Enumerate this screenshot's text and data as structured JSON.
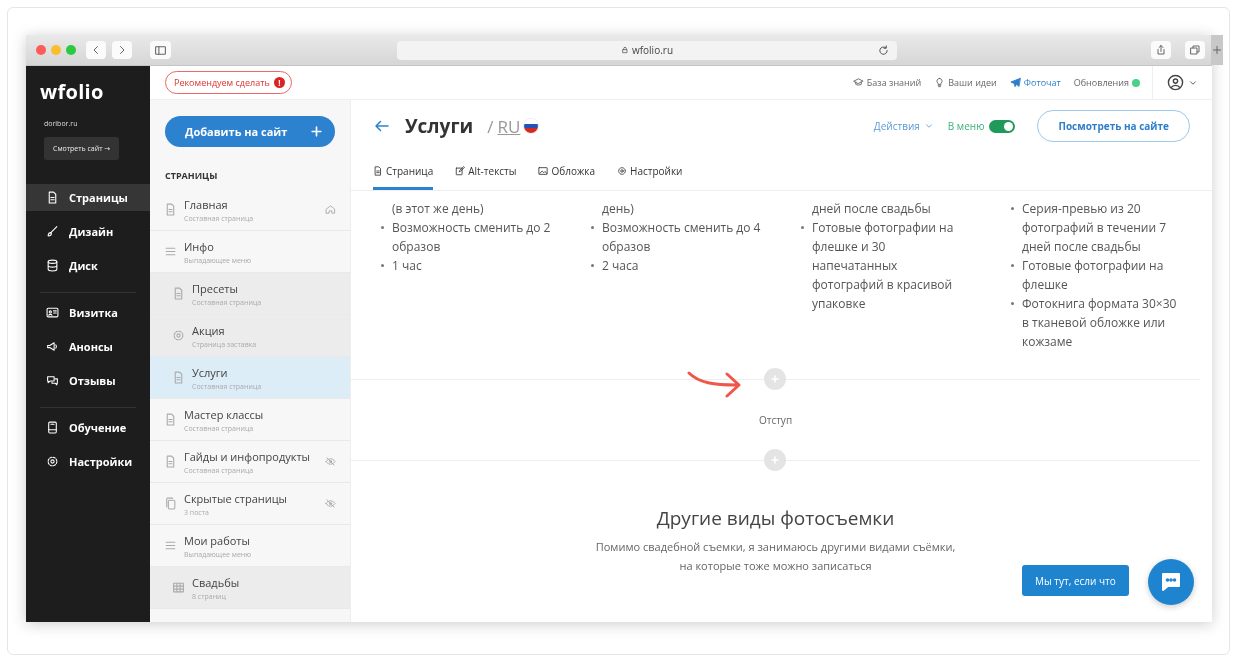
{
  "browser": {
    "url": "wfolio.ru"
  },
  "sidebar": {
    "logo": "wfolio",
    "domain": "doribor.ru",
    "view_button": "Смотреть сайт →",
    "groups": [
      [
        {
          "label": "Страницы",
          "selected": true
        },
        {
          "label": "Дизайн",
          "selected": false
        },
        {
          "label": "Диск",
          "selected": false
        }
      ],
      [
        {
          "label": "Визитка",
          "selected": false
        },
        {
          "label": "Анонсы",
          "selected": false
        },
        {
          "label": "Отзывы",
          "selected": false
        }
      ],
      [
        {
          "label": "Обучение",
          "selected": false
        },
        {
          "label": "Настройки",
          "selected": false
        }
      ]
    ]
  },
  "topbar": {
    "recommend": {
      "label": "Рекомендуем сделать",
      "badge": "!"
    },
    "links": [
      {
        "label": "База знаний",
        "highlighted": false
      },
      {
        "label": "Ваши идеи",
        "highlighted": false
      },
      {
        "label": "Фоточат",
        "highlighted": true
      },
      {
        "label": "Обновления",
        "highlighted": false
      }
    ]
  },
  "pages": {
    "add_button": "Добавить на сайт",
    "heading": "СТРАНИЦЫ",
    "items": [
      {
        "title": "Главная",
        "subtitle": "Составная страница",
        "kind": "page",
        "home": true,
        "hidden": false,
        "selected": false
      },
      {
        "title": "Инфо",
        "subtitle": "Выпадающее меню",
        "kind": "menu",
        "home": false,
        "hidden": false,
        "selected": false,
        "children": [
          {
            "title": "Пресеты",
            "subtitle": "Составная страница",
            "kind": "page",
            "home": false,
            "hidden": false,
            "selected": false
          },
          {
            "title": "Акция",
            "subtitle": "Страница заставка",
            "kind": "splash",
            "home": false,
            "hidden": false,
            "selected": false
          },
          {
            "title": "Услуги",
            "subtitle": "Составная страница",
            "kind": "page",
            "home": false,
            "hidden": false,
            "selected": true
          }
        ]
      },
      {
        "title": "Мастер классы",
        "subtitle": "Составная страница",
        "kind": "page",
        "home": false,
        "hidden": false,
        "selected": false
      },
      {
        "title": "Гайды и инфопродукты",
        "subtitle": "Составная страница",
        "kind": "page",
        "home": false,
        "hidden": true,
        "selected": false
      },
      {
        "title": "Скрытые страницы",
        "subtitle": "3 поста",
        "kind": "folder",
        "home": false,
        "hidden": true,
        "selected": false
      },
      {
        "title": "Мои работы",
        "subtitle": "Выпадающее меню",
        "kind": "menu",
        "home": false,
        "hidden": false,
        "selected": false,
        "children": [
          {
            "title": "Свадьбы",
            "subtitle": "8 страниц",
            "kind": "gallery",
            "home": false,
            "hidden": false,
            "selected": false
          }
        ]
      }
    ]
  },
  "main": {
    "title": "Услуги",
    "path_separator": "/",
    "lang": "RU",
    "actions": "Действия",
    "in_menu": {
      "label": "В меню",
      "on": true
    },
    "view_button": "Посмотреть на сайте",
    "tabs": [
      {
        "label": "Страница",
        "selected": true
      },
      {
        "label": "Alt-тексты",
        "selected": false
      },
      {
        "label": "Обложка",
        "selected": false
      },
      {
        "label": "Настройки",
        "selected": false
      }
    ],
    "columns": [
      [
        {
          "kind": "continuation",
          "text": "(в этот же день)"
        },
        {
          "kind": "bullet",
          "text": "Возможность сменить до 2 образов"
        },
        {
          "kind": "bullet",
          "text": "1 час"
        }
      ],
      [
        {
          "kind": "continuation",
          "text": "день)"
        },
        {
          "kind": "bullet",
          "text": "Возможность сменить до 4 образов"
        },
        {
          "kind": "bullet",
          "text": "2 часа"
        }
      ],
      [
        {
          "kind": "continuation",
          "text": "дней после свадьбы"
        },
        {
          "kind": "bullet",
          "text": "Готовые фотографии на флешке и 30 напечатанных фотографий в красивой упаковке"
        }
      ],
      [
        {
          "kind": "bullet",
          "text": "Серия-превью из 20 фотографий в течении 7 дней после свадьбы"
        },
        {
          "kind": "bullet",
          "text": "Готовые фотографии на флешке"
        },
        {
          "kind": "bullet",
          "text": "Фотокнига формата 30×30 в тканевой обложке или кожзаме"
        }
      ]
    ],
    "spacer_label": "Отступ",
    "section": {
      "heading": "Другие виды фотосъемки",
      "text": "Помимо свадебной съемки, я занимаюсь другими видами съёмки, на которые тоже можно записаться"
    },
    "chat": {
      "label": "Мы тут, если что"
    }
  }
}
